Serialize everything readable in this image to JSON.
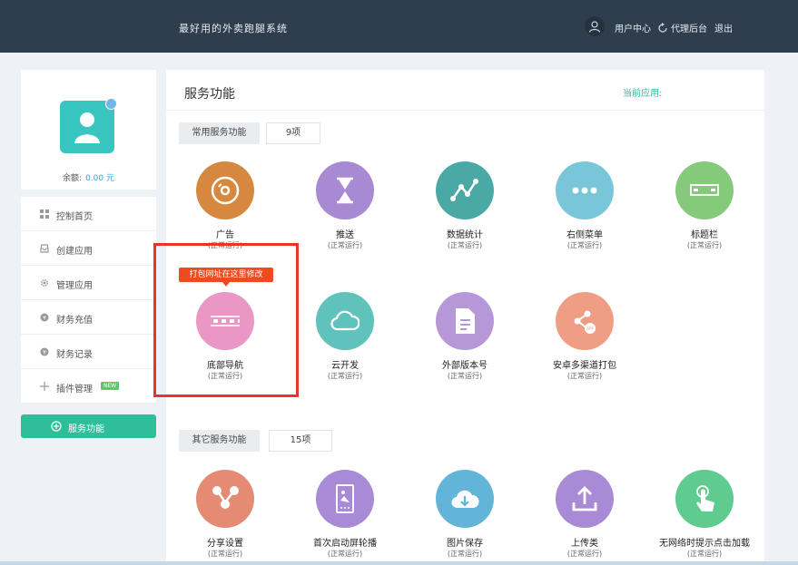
{
  "topbar": {
    "brand": "最好用的外卖跑腿系统",
    "user_center": "用户中心",
    "agent_backend": "代理后台",
    "logout": "退出"
  },
  "sidebar": {
    "balance_label": "余额:",
    "balance_value": "0.00 元",
    "items": [
      {
        "label": "控制首页",
        "icon": "grid-icon"
      },
      {
        "label": "创建应用",
        "icon": "inbox-icon"
      },
      {
        "label": "管理应用",
        "icon": "gear-icon"
      },
      {
        "label": "财务充值",
        "icon": "coin-icon"
      },
      {
        "label": "财务记录",
        "icon": "yen-icon"
      },
      {
        "label": "插件管理",
        "icon": "plus-icon",
        "badge": "NEW"
      }
    ],
    "service_button": "服务功能"
  },
  "main": {
    "title": "服务功能",
    "current_app_label": "当前应用:",
    "common_section": {
      "label": "常用服务功能",
      "count": "9项",
      "tiles": [
        {
          "name": "广告",
          "status": "(正常运行)",
          "icon": "disc-icon",
          "color": "#d5883e"
        },
        {
          "name": "推送",
          "status": "(正常运行)",
          "icon": "hourglass-icon",
          "color": "#a88ad3"
        },
        {
          "name": "数据统计",
          "status": "(正常运行)",
          "icon": "chart-line-icon",
          "color": "#4aa9a5"
        },
        {
          "name": "右侧菜单",
          "status": "(正常运行)",
          "icon": "dots-icon",
          "color": "#79c6d8"
        },
        {
          "name": "标题栏",
          "status": "(正常运行)",
          "icon": "titlebar-icon",
          "color": "#85c97a"
        },
        {
          "name": "底部导航",
          "status": "(正常运行)",
          "icon": "navbar-icon",
          "color": "#ea97c5"
        },
        {
          "name": "云开发",
          "status": "(正常运行)",
          "icon": "cloud-icon",
          "color": "#5fc2bb"
        },
        {
          "name": "外部版本号",
          "status": "(正常运行)",
          "icon": "document-icon",
          "color": "#b697d8"
        },
        {
          "name": "安卓多渠道打包",
          "status": "(正常运行)",
          "icon": "share-apk-icon",
          "color": "#ef9e85"
        }
      ]
    },
    "tooltip": "打包网址在这里修改",
    "other_section": {
      "label": "其它服务功能",
      "count": "15项",
      "tiles": [
        {
          "name": "分享设置",
          "status": "(正常运行)",
          "icon": "share-icon",
          "color": "#e58a73"
        },
        {
          "name": "首次启动屏轮播",
          "status": "(正常运行)",
          "icon": "phone-image-icon",
          "color": "#a98ad6"
        },
        {
          "name": "图片保存",
          "status": "(正常运行)",
          "icon": "cloud-download-icon",
          "color": "#62b5d7"
        },
        {
          "name": "上传类",
          "status": "(正常运行)",
          "icon": "upload-icon",
          "color": "#a98ad6"
        },
        {
          "name": "无网络时提示点击加载",
          "status": "(正常运行)",
          "icon": "tap-icon",
          "color": "#5fcb8e"
        }
      ]
    }
  },
  "colors": {
    "topbar_bg": "#2f3e4e",
    "accent": "#2fbe9a",
    "highlight": "#e8342a",
    "tooltip_bg": "#f04a1f"
  }
}
